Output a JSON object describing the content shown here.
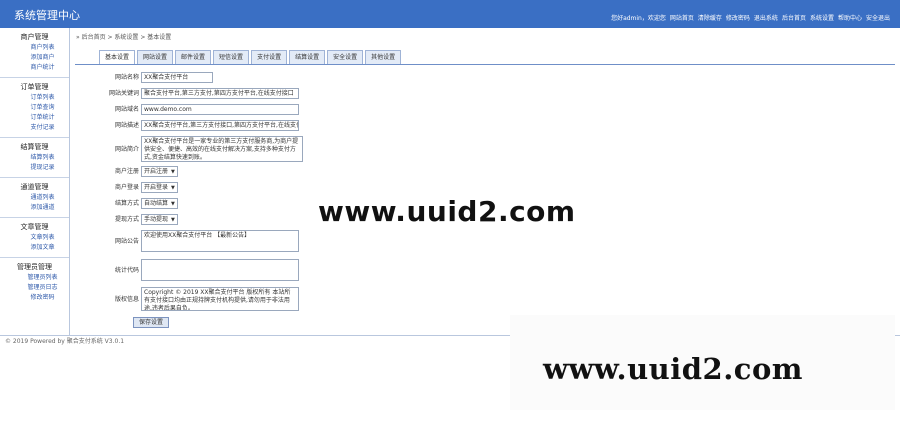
{
  "header": {
    "title": "系统管理中心",
    "links": [
      "您好admin，欢迎您",
      "网站首页",
      "清除缓存",
      "修改密码",
      "退出系统",
      "后台首页",
      "系统设置",
      "帮助中心",
      "安全退出"
    ]
  },
  "sidebar": {
    "groups": [
      {
        "title": "商户管理",
        "items": [
          "商户列表",
          "添加商户",
          "商户统计"
        ]
      },
      {
        "title": "订单管理",
        "items": [
          "订单列表",
          "订单查询",
          "订单统计",
          "支付记录"
        ]
      },
      {
        "title": "结算管理",
        "items": [
          "结算列表",
          "提现记录"
        ]
      },
      {
        "title": "通道管理",
        "items": [
          "通道列表",
          "添加通道"
        ]
      },
      {
        "title": "文章管理",
        "items": [
          "文章列表",
          "添加文章"
        ]
      },
      {
        "title": "管理员管理",
        "items": [
          "管理员列表",
          "管理员日志",
          "修改密码"
        ]
      }
    ]
  },
  "breadcrumb": "» 后台首页 > 系统设置 > 基本设置",
  "tabs": [
    "基本设置",
    "网站设置",
    "邮件设置",
    "短信设置",
    "支付设置",
    "结算设置",
    "安全设置",
    "其他设置"
  ],
  "form": {
    "site_name": {
      "label": "网站名称",
      "value": "XX聚合支付平台"
    },
    "keywords": {
      "label": "网站关键词",
      "value": "聚合支付平台,第三方支付,第四方支付平台,在线支付接口"
    },
    "domain": {
      "label": "网站域名",
      "value": "www.demo.com"
    },
    "description": {
      "label": "网站描述",
      "value": "XX聚合支付平台,第三方支付接口,第四方支付平台,在线支付"
    },
    "intro": {
      "label": "网站简介",
      "value": "XX聚合支付平台是一家专业的第三方支付服务商,为商户提供安全、便捷、高效的在线支付解决方案,支持多种支付方式,资金结算快速到账。"
    },
    "reg_open": {
      "label": "商户注册",
      "value": "开启注册"
    },
    "login_open": {
      "label": "商户登录",
      "value": "开启登录"
    },
    "settle_mode": {
      "label": "结算方式",
      "value": "自动结算"
    },
    "withdraw_mode": {
      "label": "提现方式",
      "value": "手动提现"
    },
    "notice": {
      "label": "网站公告",
      "value": "欢迎使用XX聚合支付平台 【最新公告】"
    },
    "stat_code": {
      "label": "统计代码",
      "value": ""
    },
    "copyright": {
      "label": "版权信息",
      "value": "Copyright © 2019 XX聚合支付平台 版权所有 本站所有支付接口均由正规持牌支付机构提供,请勿用于非法用途,违者后果自负。"
    },
    "submit_label": "保存设置"
  },
  "footer": "© 2019 Powered by 聚合支付系统 V3.0.1",
  "watermark": {
    "text1": "www.uuid2.com",
    "text2": "www.uuid2.com"
  }
}
